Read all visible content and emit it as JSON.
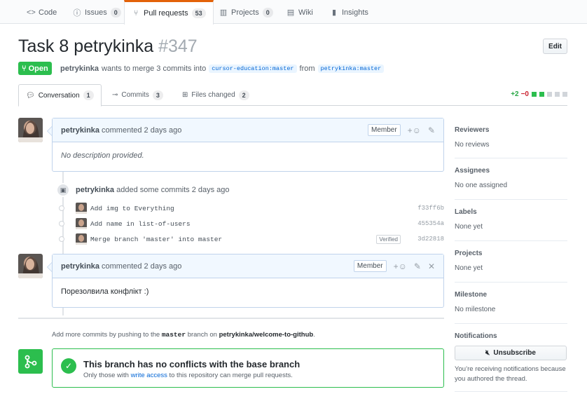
{
  "reponav": {
    "tabs": [
      {
        "icon": "code-icon",
        "label": "Code",
        "count": ""
      },
      {
        "icon": "issue-icon",
        "label": "Issues",
        "count": "0"
      },
      {
        "icon": "pull-request-icon",
        "label": "Pull requests",
        "count": "53"
      },
      {
        "icon": "project-icon",
        "label": "Projects",
        "count": "0"
      },
      {
        "icon": "wiki-icon",
        "label": "Wiki",
        "count": ""
      },
      {
        "icon": "graph-icon",
        "label": "Insights",
        "count": ""
      }
    ],
    "active": "Pull requests"
  },
  "pr": {
    "title": "Task 8 petrykinka",
    "number": "#347",
    "edit_label": "Edit",
    "state": "Open",
    "author": "petrykinka",
    "merge_text": "wants to merge 3 commits into",
    "base_branch": "cursor-education:master",
    "from_text": "from",
    "head_branch": "petrykinka:master"
  },
  "tabs": {
    "conversation": {
      "label": "Conversation",
      "count": "1"
    },
    "commits": {
      "label": "Commits",
      "count": "3"
    },
    "files": {
      "label": "Files changed",
      "count": "2"
    },
    "additions": "+2",
    "deletions": "−0"
  },
  "timeline": {
    "comment1": {
      "author": "petrykinka",
      "meta": "commented 2 days ago",
      "badge": "Member",
      "body": "No description provided."
    },
    "commits_event": {
      "author": "petrykinka",
      "meta": "added some commits 2 days ago",
      "items": [
        {
          "message": "Add img to Everything",
          "verified": "",
          "sha": "f33ff6b"
        },
        {
          "message": "Add name in list-of-users",
          "verified": "",
          "sha": "455354a"
        },
        {
          "message": "Merge branch 'master' into master",
          "verified": "Verified",
          "sha": "3d22818"
        }
      ]
    },
    "comment2": {
      "author": "petrykinka",
      "meta": "commented 2 days ago",
      "badge": "Member",
      "body": "Порезолвила конфлікт :)"
    },
    "push_note": {
      "prefix": "Add more commits by pushing to the",
      "branch": "master",
      "middle": "branch on",
      "repo": "petrykinka/welcome-to-github",
      "suffix": "."
    },
    "merge": {
      "title": "This branch has no conflicts with the base branch",
      "sub_prefix": "Only those with",
      "sub_link": "write access",
      "sub_suffix": "to this repository can merge pull requests."
    }
  },
  "sidebar": {
    "reviewers": {
      "heading": "Reviewers",
      "value": "No reviews"
    },
    "assignees": {
      "heading": "Assignees",
      "value": "No one assigned"
    },
    "labels": {
      "heading": "Labels",
      "value": "None yet"
    },
    "projects": {
      "heading": "Projects",
      "value": "None yet"
    },
    "milestone": {
      "heading": "Milestone",
      "value": "No milestone"
    },
    "notifications": {
      "heading": "Notifications",
      "button": "Unsubscribe",
      "reason": "You’re receiving notifications because you authored the thread."
    }
  },
  "colors": {
    "open_green": "#2cbe4e",
    "accent_orange": "#e36209",
    "link_blue": "#0366d6"
  }
}
